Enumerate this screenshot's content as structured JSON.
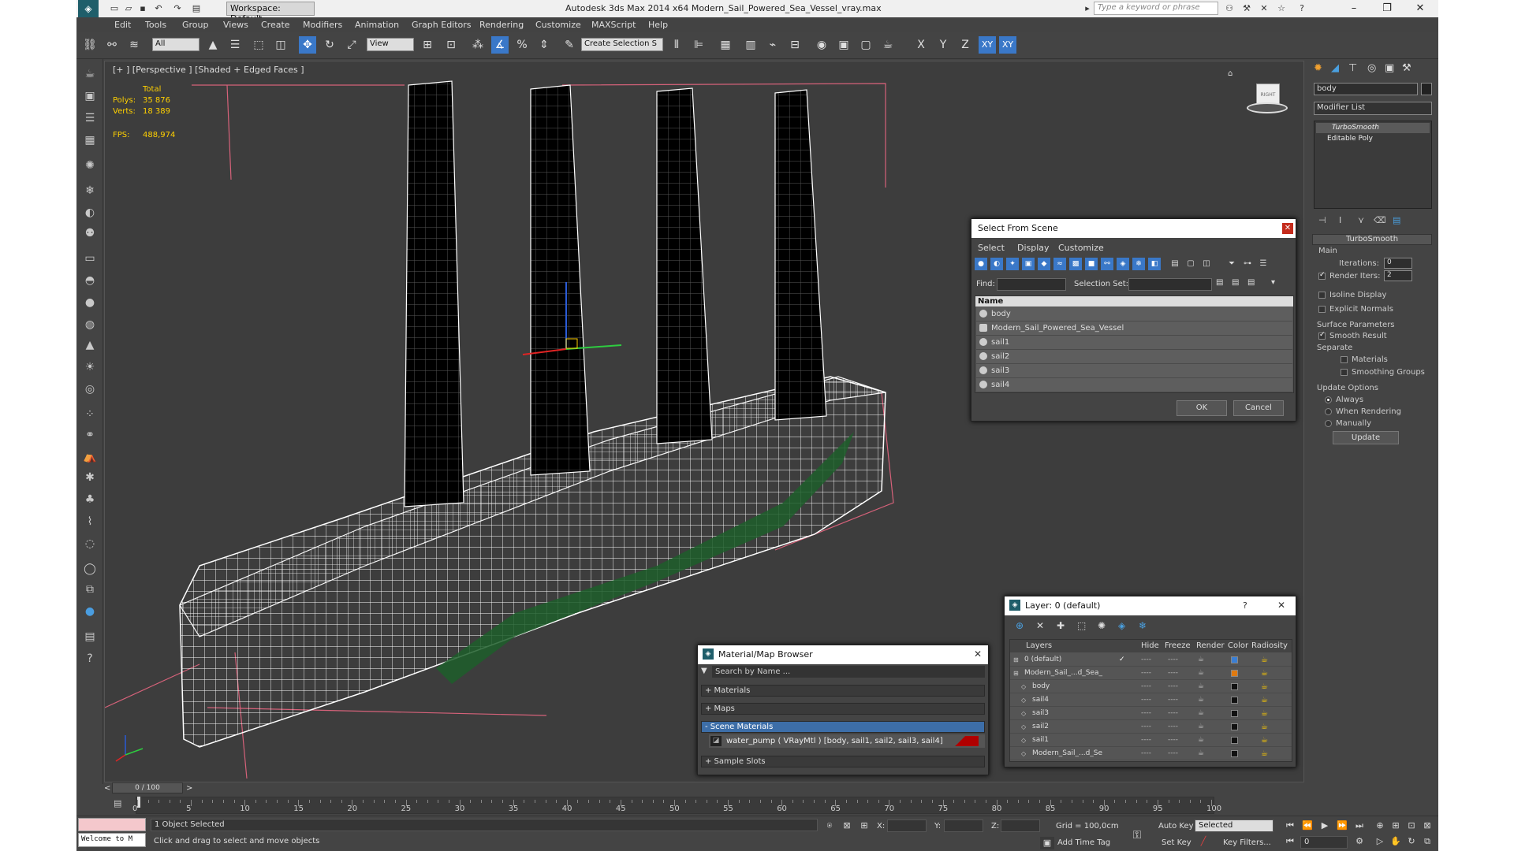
{
  "app": {
    "title": "Autodesk 3ds Max  2014 x64    Modern_Sail_Powered_Sea_Vessel_vray.max",
    "workspace": "Workspace: Default",
    "search_placeholder": "Type a keyword or phrase"
  },
  "menu": [
    "Edit",
    "Tools",
    "Group",
    "Views",
    "Create",
    "Modifiers",
    "Animation",
    "Graph Editors",
    "Rendering",
    "Customize",
    "MAXScript",
    "Help"
  ],
  "toolbar": {
    "selection_filter": "All",
    "ref_coord": "View",
    "named_selection": "Create Selection S",
    "axis_x": "X",
    "axis_y": "Y",
    "axis_z": "Z",
    "axis_xy": "XY",
    "axis_xy2": "XY"
  },
  "viewport": {
    "label": "[+ ] [Perspective ] [Shaded + Edged Faces ]",
    "stats": {
      "total_label": "Total",
      "polys_label": "Polys:",
      "polys_value": "35 876",
      "verts_label": "Verts:",
      "verts_value": "18 389",
      "fps_label": "FPS:",
      "fps_value": "488,974"
    },
    "viewcube_label": "RIGHT"
  },
  "command_panel": {
    "object_name": "body",
    "modifier_list": "Modifier List",
    "stack": [
      "TurboSmooth",
      "Editable Poly"
    ],
    "turbosmooth": {
      "title": "TurboSmooth",
      "main": "Main",
      "iterations_label": "Iterations:",
      "iterations_value": "0",
      "render_iters_label": "Render Iters:",
      "render_iters_value": "2",
      "isoline": "Isoline Display",
      "explicit_normals": "Explicit Normals",
      "surface_params": "Surface Parameters",
      "smooth_result": "Smooth Result",
      "separate": "Separate",
      "materials": "Materials",
      "smoothing_groups": "Smoothing Groups",
      "update_options": "Update Options",
      "always": "Always",
      "when_rendering": "When Rendering",
      "manually": "Manually",
      "update_btn": "Update"
    }
  },
  "select_from_scene": {
    "title": "Select From Scene",
    "menu": [
      "Select",
      "Display",
      "Customize"
    ],
    "find_label": "Find:",
    "selection_set_label": "Selection Set:",
    "column_name": "Name",
    "items": [
      "body",
      "Modern_Sail_Powered_Sea_Vessel",
      "sail1",
      "sail2",
      "sail3",
      "sail4"
    ],
    "ok": "OK",
    "cancel": "Cancel"
  },
  "material_browser": {
    "title": "Material/Map Browser",
    "search_placeholder": "Search by Name ...",
    "sections": [
      "+ Materials",
      "+ Maps",
      "- Scene Materials"
    ],
    "material_entry": "water_pump  ( VRayMtl ) [body, sail1, sail2, sail3, sail4]",
    "sample_slots": "+ Sample Slots"
  },
  "layer_dialog": {
    "title": "Layer: 0 (default)",
    "help": "?",
    "columns": [
      "Layers",
      "Hide",
      "Freeze",
      "Render",
      "Color",
      "Radiosity"
    ],
    "rows": [
      {
        "name": "0 (default)",
        "color": "#3a7fd5",
        "indent": 0,
        "check": "✓"
      },
      {
        "name": "Modern_Sail_...d_Sea_",
        "color": "#e07a10",
        "indent": 0,
        "check": ""
      },
      {
        "name": "body",
        "color": "#111111",
        "indent": 1,
        "check": ""
      },
      {
        "name": "sail4",
        "color": "#111111",
        "indent": 1,
        "check": ""
      },
      {
        "name": "sail3",
        "color": "#111111",
        "indent": 1,
        "check": ""
      },
      {
        "name": "sail2",
        "color": "#111111",
        "indent": 1,
        "check": ""
      },
      {
        "name": "sail1",
        "color": "#111111",
        "indent": 1,
        "check": ""
      },
      {
        "name": "Modern_Sail_...d_Se",
        "color": "#111111",
        "indent": 1,
        "check": ""
      }
    ],
    "dash": "----"
  },
  "timeline": {
    "frame": "0 / 100",
    "ticks": [
      "0",
      "5",
      "10",
      "15",
      "20",
      "25",
      "30",
      "35",
      "40",
      "45",
      "50",
      "55",
      "60",
      "65",
      "70",
      "75",
      "80",
      "85",
      "90",
      "95",
      "100"
    ]
  },
  "status": {
    "maxscript": "Welcome to M",
    "selected": "1 Object Selected",
    "prompt": "Click and drag to select and move objects",
    "x_label": "X:",
    "y_label": "Y:",
    "z_label": "Z:",
    "grid": "Grid = 100,0cm",
    "add_time_tag": "Add Time Tag",
    "auto_key": "Auto Key",
    "set_key": "Set Key",
    "selected_dropdown": "Selected",
    "key_filters": "Key Filters...",
    "frame_value": "0"
  }
}
